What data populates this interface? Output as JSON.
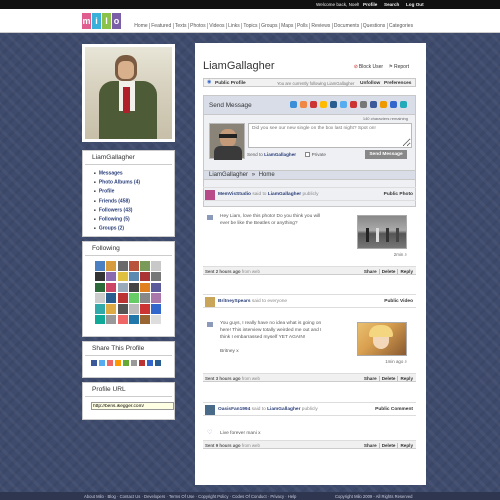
{
  "topbar": {
    "welcome": "Welcome back, Noel!",
    "profile": "Profile",
    "search": "Search",
    "logout": "Log Out"
  },
  "logo": {
    "letters": [
      "m",
      "i",
      "l",
      "o"
    ],
    "colors": [
      "#e05d8f",
      "#3bb0d9",
      "#8bc34a",
      "#7a5ea8"
    ]
  },
  "nav": [
    "Home",
    "Featured",
    "Texts",
    "Photos",
    "Videos",
    "Links",
    "Topics",
    "Groups",
    "Maps",
    "Polls",
    "Reviews",
    "Documents",
    "Questions",
    "Categories"
  ],
  "menu": {
    "title": "LiamGallagher",
    "items": [
      "Messages",
      "Photo Albums (4)",
      "Profile",
      "Friends (458)",
      "Followers (43)",
      "Following (5)",
      "Groups (2)"
    ]
  },
  "following": {
    "title": "Following",
    "avatar_colors": [
      "#4a7fc1",
      "#d59b3c",
      "#6a6a6a",
      "#b9523b",
      "#7a9a5a",
      "#c8c8c8",
      "#333",
      "#8a6bb0",
      "#e0c040",
      "#5a8ab0",
      "#aa3333",
      "#777",
      "#2d6a3a",
      "#c46",
      "#9ab",
      "#444",
      "#e08020",
      "#5b5b9b",
      "#ccc",
      "#2a5d8f",
      "#b33",
      "#6c6",
      "#888",
      "#a7a",
      "#3aa",
      "#da4",
      "#555",
      "#bcbcbc",
      "#c33",
      "#36c",
      "#1a9",
      "#999",
      "#e66",
      "#27a",
      "#963",
      "#ddd"
    ]
  },
  "share": {
    "title": "Share This Profile",
    "icon_colors": [
      "#3b5998",
      "#55acee",
      "#e66",
      "#f90",
      "#6a3",
      "#999",
      "#b33",
      "#36c",
      "#2a5d8f"
    ]
  },
  "purl": {
    "title": "Profile URL",
    "value": "http://bens.ikegger.com/"
  },
  "profile": {
    "name": "LiamGallagher",
    "block": "Block User",
    "report": "Report",
    "public_label": "Public Profile",
    "following_text": "You are currently following LiamGallagher",
    "unfollow": "Unfollow",
    "preferences": "Preferences"
  },
  "send": {
    "title": "Send Message",
    "chars": "140 characters remaining",
    "placeholder": "Did you see our new single on the box last night? Spot on!",
    "send_to": "Send to",
    "send_to_name": "LiamGallagher",
    "private": "Private",
    "button": "Send Message",
    "icon_colors": [
      "#3b8fd9",
      "#e84",
      "#c33",
      "#fb0",
      "#2a5d8f",
      "#55acee",
      "#c33",
      "#777",
      "#3b5998",
      "#e90",
      "#36c",
      "#2ab"
    ]
  },
  "crumb": {
    "user": "LiamGallagher",
    "sep": "»",
    "page": "Home"
  },
  "posts": [
    {
      "author": "MemVisStudio",
      "said": "said to",
      "target": "LiamGallagher",
      "scope": "publicly",
      "kind": "Public Photo",
      "msg": [
        "Hey Liam, love this photo! Do you think you will",
        "ever be like the Beatles or anything?"
      ],
      "meta": "2min",
      "time_b": "Sent 2 hours ago",
      "time_rest": "from web",
      "links": [
        "Share",
        "Delete",
        "Reply"
      ]
    },
    {
      "author": "BritneySpears",
      "said": "said to everyone",
      "target": "",
      "scope": "",
      "kind": "Public Video",
      "msg": [
        "You guys, I really have no idea what is going on",
        "here! This interview totally weirded me out and I",
        "think I embarrassed myself YET AGAIN!",
        "",
        "Britney x"
      ],
      "meta": "1min ago",
      "time_b": "Sent 3 hours ago",
      "time_rest": "from web",
      "links": [
        "Share",
        "Delete",
        "Reply"
      ]
    },
    {
      "author": "OasisFan1994",
      "said": "said to",
      "target": "LiamGallagher",
      "scope": "publicly",
      "kind": "Public Comment",
      "msg": [
        "Live forever mani x"
      ],
      "meta": "",
      "time_b": "Sent 9 hours ago",
      "time_rest": "from web",
      "links": [
        "Share",
        "Delete",
        "Reply"
      ]
    }
  ],
  "footer": {
    "links": "About Milo · Blog · Contact Us · Developers · Terms Of Use · Copyright Policy · Codes Of Conduct · Privacy · Help",
    "copy": "Copyright Milo 2009 - All Rights Reserved"
  }
}
